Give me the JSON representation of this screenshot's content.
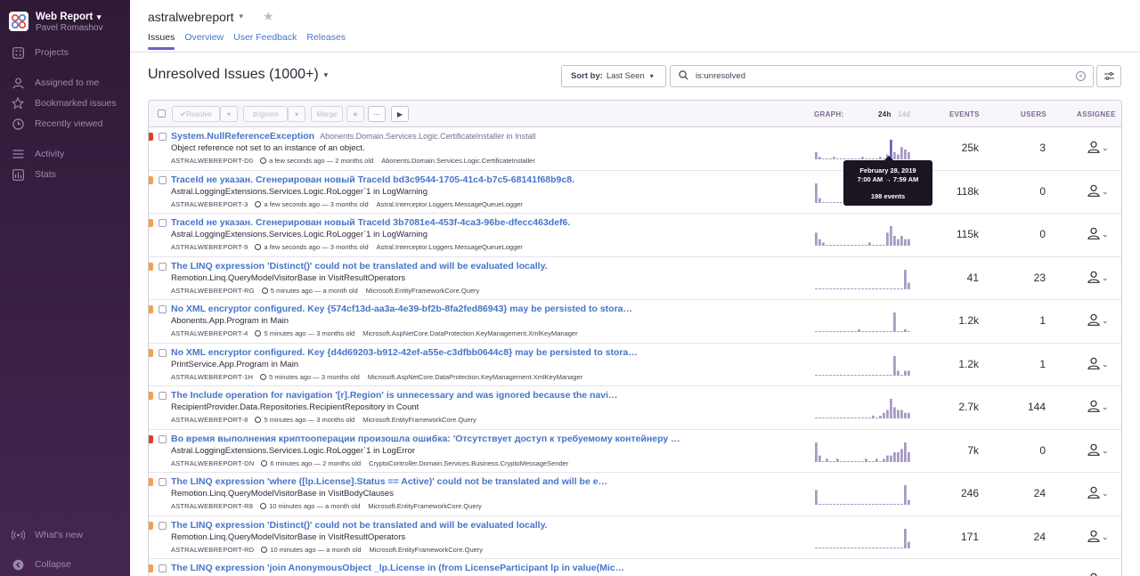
{
  "sidebar": {
    "org_name": "Web Report",
    "user_name": "Pavel Romashov",
    "items": [
      {
        "label": "Projects",
        "icon": "projects-icon"
      },
      {
        "label": "Assigned to me",
        "icon": "user-icon"
      },
      {
        "label": "Bookmarked issues",
        "icon": "star-icon"
      },
      {
        "label": "Recently viewed",
        "icon": "history-icon"
      },
      {
        "label": "Activity",
        "icon": "activity-icon"
      },
      {
        "label": "Stats",
        "icon": "stats-icon"
      },
      {
        "label": "What's new",
        "icon": "broadcast-icon"
      },
      {
        "label": "Collapse",
        "icon": "collapse-icon"
      }
    ]
  },
  "header": {
    "project_name": "astralwebreport",
    "tabs": [
      "Issues",
      "Overview",
      "User Feedback",
      "Releases"
    ],
    "active_tab": "Issues"
  },
  "main": {
    "title": "Unresolved Issues (1000+)",
    "sort_label": "Sort by:",
    "sort_value": "Last Seen",
    "search_value": "is:unresolved"
  },
  "toolbar": {
    "resolve": "Resolve",
    "ignore": "Ignore",
    "merge": "Merge",
    "more": "···"
  },
  "columns": {
    "graph": "GRAPH:",
    "period_24h": "24h",
    "period_14d": "14d",
    "events": "EVENTS",
    "users": "USERS",
    "assignee": "ASSIGNEE"
  },
  "colors": {
    "error": "#e03e2f",
    "warning": "#f5a049",
    "link": "#4674ca",
    "accent": "#6c5fc7",
    "sidebar": "#2f1937"
  },
  "tooltip": {
    "date": "February 28, 2019",
    "range": "7:00 AM → 7:59 AM",
    "events": "198 events"
  },
  "issues": [
    {
      "level": "error",
      "title": "System.NullReferenceException",
      "subtitle": "Abonents.Domain.Services.Logic.CertificateInstaller in Install",
      "message": "Object reference not set to an instance of an object.",
      "short_id": "ASTRALWEBREPORT-D0",
      "time": "a few seconds ago — 2 months old",
      "culprit": "Abonents.Domain.Services.Logic.CertificateInstaller",
      "events": "25k",
      "users": "3",
      "spark": [
        3,
        1,
        0,
        0,
        0,
        1,
        0,
        0,
        0,
        0,
        0,
        0,
        0,
        1,
        0,
        0,
        0,
        0,
        1,
        0,
        2,
        8,
        3,
        2,
        5,
        4,
        3
      ]
    },
    {
      "level": "warning",
      "title": "TraceId не указан. Сгенерирован новый TraceId bd3c9544-1705-41c4-b7c5-68141f68b9c8.",
      "subtitle": "",
      "message": "Astral.LoggingExtensions.Services.Logic.RoLogger`1 in LogWarning",
      "short_id": "ASTRALWEBREPORT-3",
      "time": "a few seconds ago — 3 months old",
      "culprit": "Astral.Interceptor.Loggers.MessageQueueLogger",
      "events": "118k",
      "users": "0",
      "spark": [
        4,
        1,
        0,
        0,
        0,
        0,
        0,
        0,
        0,
        0,
        0,
        0,
        0,
        0,
        0,
        0,
        0,
        0,
        0,
        0,
        0,
        0,
        0,
        0,
        0,
        0,
        0
      ]
    },
    {
      "level": "warning",
      "title": "TraceId не указан. Сгенерирован новый TraceId 3b7081e4-453f-4ca3-96be-dfecc463def6.",
      "subtitle": "",
      "message": "Astral.LoggingExtensions.Services.Logic.RoLogger`1 in LogWarning",
      "short_id": "ASTRALWEBREPORT-9",
      "time": "a few seconds ago — 3 months old",
      "culprit": "Astral.Interceptor.Loggers.MessageQueueLogger",
      "events": "115k",
      "users": "0",
      "spark": [
        4,
        2,
        1,
        0,
        0,
        0,
        0,
        0,
        0,
        0,
        0,
        0,
        0,
        0,
        0,
        1,
        0,
        0,
        0,
        0,
        4,
        6,
        3,
        2,
        3,
        2,
        2
      ]
    },
    {
      "level": "warning",
      "title": "The LINQ expression 'Distinct()' could not be translated and will be evaluated locally.",
      "subtitle": "",
      "message": "Remotion.Linq.QueryModelVisitorBase in VisitResultOperators",
      "short_id": "ASTRALWEBREPORT-RG",
      "time": "5 minutes ago — a month old",
      "culprit": "Microsoft.EntityFrameworkCore.Query",
      "events": "41",
      "users": "23",
      "spark": [
        0,
        0,
        0,
        0,
        0,
        0,
        0,
        0,
        0,
        0,
        0,
        0,
        0,
        0,
        0,
        0,
        0,
        0,
        0,
        0,
        0,
        0,
        0,
        0,
        0,
        3,
        1
      ]
    },
    {
      "level": "warning",
      "title": "No XML encryptor configured. Key {574cf13d-aa3a-4e39-bf2b-8fa2fed86943} may be persisted to stora…",
      "subtitle": "",
      "message": "Abonents.App.Program in Main",
      "short_id": "ASTRALWEBREPORT-4",
      "time": "5 minutes ago — 3 months old",
      "culprit": "Microsoft.AspNetCore.DataProtection.KeyManagement.XmlKeyManager",
      "events": "1.2k",
      "users": "1",
      "spark": [
        0,
        0,
        0,
        0,
        0,
        0,
        0,
        0,
        0,
        0,
        0,
        0,
        1,
        0,
        0,
        0,
        0,
        0,
        0,
        0,
        0,
        0,
        7,
        0,
        0,
        1,
        0
      ]
    },
    {
      "level": "warning",
      "title": "No XML encryptor configured. Key {d4d69203-b912-42ef-a55e-c3dfbb0644c8} may be persisted to stora…",
      "subtitle": "",
      "message": "PrintService.App.Program in Main",
      "short_id": "ASTRALWEBREPORT-1H",
      "time": "5 minutes ago — 3 months old",
      "culprit": "Microsoft.AspNetCore.DataProtection.KeyManagement.XmlKeyManager",
      "events": "1.2k",
      "users": "1",
      "spark": [
        0,
        0,
        0,
        0,
        0,
        0,
        0,
        0,
        0,
        0,
        0,
        0,
        0,
        0,
        0,
        0,
        0,
        0,
        0,
        0,
        0,
        0,
        4,
        1,
        0,
        1,
        1
      ]
    },
    {
      "level": "warning",
      "title": "The Include operation for navigation '[r].Region' is unnecessary and was ignored because the navi…",
      "subtitle": "",
      "message": "RecipientProvider.Data.Repositories.RecipientRepository in Count",
      "short_id": "ASTRALWEBREPORT-8",
      "time": "5 minutes ago — 3 months old",
      "culprit": "Microsoft.EntityFrameworkCore.Query",
      "events": "2.7k",
      "users": "144",
      "spark": [
        0,
        0,
        0,
        0,
        0,
        0,
        0,
        0,
        0,
        0,
        0,
        0,
        0,
        0,
        0,
        0,
        1,
        0,
        1,
        2,
        3,
        7,
        4,
        3,
        3,
        2,
        2
      ]
    },
    {
      "level": "error",
      "title": "Во время выполнения криптооперации произошла ошибка: 'Отсутствует доступ к требуемому контейнеру …",
      "subtitle": "",
      "message": "Astral.LoggingExtensions.Services.Logic.RoLogger`1 in LogError",
      "short_id": "ASTRALWEBREPORT-DN",
      "time": "6 minutes ago — 2 months old",
      "culprit": "CryptoController.Domain.Services.Business.CryptoMessageSender",
      "events": "7k",
      "users": "0",
      "spark": [
        6,
        2,
        0,
        1,
        0,
        0,
        1,
        0,
        0,
        0,
        0,
        0,
        0,
        0,
        1,
        0,
        0,
        1,
        0,
        1,
        2,
        2,
        3,
        3,
        4,
        6,
        3
      ]
    },
    {
      "level": "warning",
      "title": "The LINQ expression 'where ([lp.License].Status == Active)' could not be translated and will be e…",
      "subtitle": "",
      "message": "Remotion.Linq.QueryModelVisitorBase in VisitBodyClauses",
      "short_id": "ASTRALWEBREPORT-R8",
      "time": "10 minutes ago — a month old",
      "culprit": "Microsoft.EntityFrameworkCore.Query",
      "events": "246",
      "users": "24",
      "spark": [
        3,
        0,
        0,
        0,
        0,
        0,
        0,
        0,
        0,
        0,
        0,
        0,
        0,
        0,
        0,
        0,
        0,
        0,
        0,
        0,
        0,
        0,
        0,
        0,
        0,
        4,
        1
      ]
    },
    {
      "level": "warning",
      "title": "The LINQ expression 'Distinct()' could not be translated and will be evaluated locally.",
      "subtitle": "",
      "message": "Remotion.Linq.QueryModelVisitorBase in VisitResultOperators",
      "short_id": "ASTRALWEBREPORT-RD",
      "time": "10 minutes ago — a month old",
      "culprit": "Microsoft.EntityFrameworkCore.Query",
      "events": "171",
      "users": "24",
      "spark": [
        0,
        0,
        0,
        0,
        0,
        0,
        0,
        0,
        0,
        0,
        0,
        0,
        0,
        0,
        0,
        0,
        0,
        0,
        0,
        0,
        0,
        0,
        0,
        0,
        0,
        3,
        1
      ]
    },
    {
      "level": "warning",
      "title": "The LINQ expression 'join AnonymousObject _lp.License in (from LicenseParticipant lp in value(Mic…",
      "subtitle": "",
      "message": "",
      "short_id": "",
      "time": "",
      "culprit": "",
      "events": "",
      "users": "",
      "spark": []
    }
  ]
}
